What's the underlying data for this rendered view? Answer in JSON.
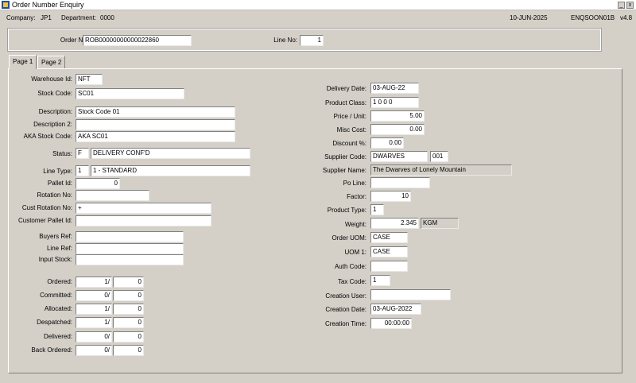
{
  "window": {
    "title": "Order Number Enquiry",
    "minimize": "_",
    "close": "x"
  },
  "info": {
    "company_label": "Company:",
    "company": "JP1",
    "department_label": "Department:",
    "department": "0000",
    "date": "10-JUN-2025",
    "program": "ENQSOON01B",
    "version": "v4.8"
  },
  "header": {
    "order_no_label": "Order No:",
    "order_no": "ROB00000000000022860",
    "line_no_label": "Line No:",
    "line_no": "1"
  },
  "tabs": [
    "Page 1",
    "Page 2"
  ],
  "left": {
    "warehouse_label": "Warehouse Id:",
    "warehouse": "NFT",
    "stock_code_label": "Stock Code:",
    "stock_code": "SC01",
    "description_label": "Description:",
    "description": "Stock Code 01",
    "description2_label": "Description 2:",
    "description2": "",
    "aka_label": "AKA Stock Code:",
    "aka": "AKA SC01",
    "status_label": "Status:",
    "status_code": "F",
    "status_desc": "DELIVERY CONF'D",
    "line_type_label": "Line Type:",
    "line_type_code": "1",
    "line_type_desc": "1 - STANDARD",
    "pallet_id_label": "Pallet Id:",
    "pallet_id": "0",
    "rotation_label": "Rotation No:",
    "rotation": "",
    "cust_rotation_label": "Cust Rotation No:",
    "cust_rotation": "+",
    "cust_pallet_label": "Customer Pallet Id:",
    "cust_pallet": "",
    "buyers_ref_label": "Buyers Ref:",
    "buyers_ref": "",
    "line_ref_label": "Line Ref:",
    "line_ref": "",
    "input_stock_label": "Input Stock:",
    "input_stock": ""
  },
  "quantities": [
    {
      "label": "Ordered:",
      "a": "1/",
      "b": "0"
    },
    {
      "label": "Committed:",
      "a": "0/",
      "b": "0"
    },
    {
      "label": "Allocated:",
      "a": "1/",
      "b": "0"
    },
    {
      "label": "Despatched:",
      "a": "1/",
      "b": "0"
    },
    {
      "label": "Delivered:",
      "a": "0/",
      "b": "0"
    },
    {
      "label": "Back Ordered:",
      "a": "0/",
      "b": "0"
    }
  ],
  "right": {
    "delivery_date_label": "Delivery Date:",
    "delivery_date": "03-AUG-22",
    "product_class_label": "Product Class:",
    "product_class": "1 0 0 0",
    "price_label": "Price / Unit:",
    "price": "5.00",
    "misc_cost_label": "Misc Cost:",
    "misc_cost": "0.00",
    "discount_label": "Discount %:",
    "discount": "0.00",
    "supplier_code_label": "Supplier Code:",
    "supplier_code": "DWARVES",
    "supplier_suffix": "001",
    "supplier_name_label": "Supplier Name:",
    "supplier_name": "The Dwarves of Lonely Mountain",
    "po_line_label": "Po Line:",
    "po_line": "",
    "factor_label": "Factor:",
    "factor": "10",
    "product_type_label": "Product Type:",
    "product_type": "1",
    "weight_label": "Weight:",
    "weight": "2.345",
    "weight_unit": "KGM",
    "order_uom_label": "Order UOM:",
    "order_uom": "CASE",
    "uom1_label": "UOM 1:",
    "uom1": "CASE",
    "auth_code_label": "Auth Code:",
    "auth_code": "",
    "tax_code_label": "Tax Code:",
    "tax_code": "1",
    "creation_user_label": "Creation User:",
    "creation_user": "",
    "creation_date_label": "Creation Date:",
    "creation_date": "03-AUG-2022",
    "creation_time_label": "Creation Time:",
    "creation_time": "00:00:00"
  }
}
